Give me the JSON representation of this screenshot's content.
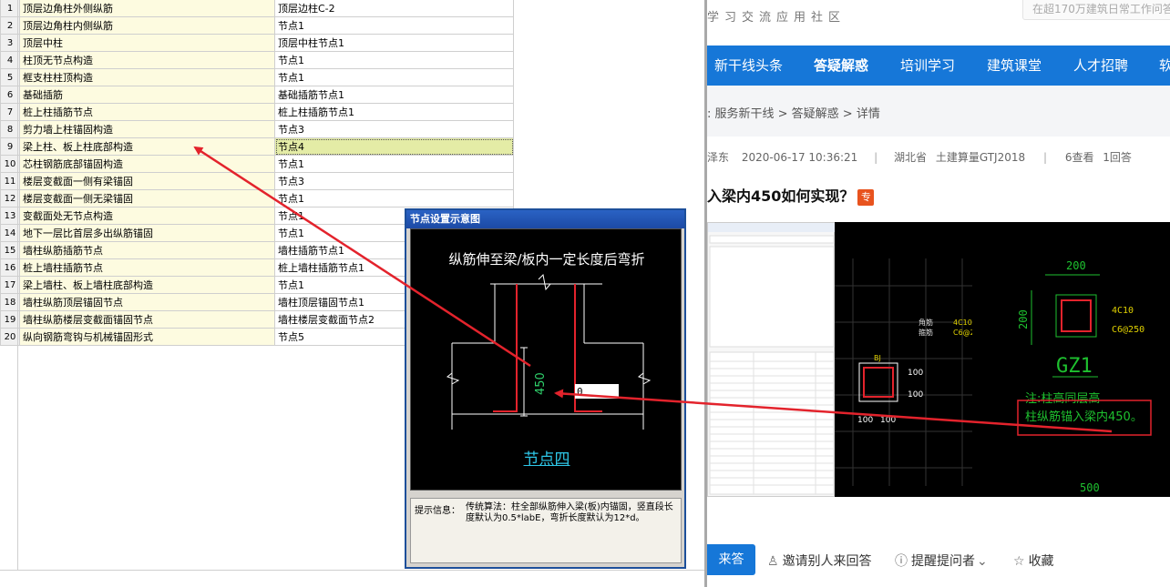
{
  "settings_table": {
    "rows": [
      {
        "num": "1",
        "name": "顶层边角柱外侧纵筋",
        "value": "顶层边柱C-2"
      },
      {
        "num": "2",
        "name": "顶层边角柱内侧纵筋",
        "value": "节点1"
      },
      {
        "num": "3",
        "name": "顶层中柱",
        "value": "顶层中柱节点1"
      },
      {
        "num": "4",
        "name": "柱顶无节点构造",
        "value": "节点1"
      },
      {
        "num": "5",
        "name": "框支柱柱顶构造",
        "value": "节点1"
      },
      {
        "num": "6",
        "name": "基础插筋",
        "value": "基础插筋节点1"
      },
      {
        "num": "7",
        "name": "桩上柱插筋节点",
        "value": "桩上柱插筋节点1"
      },
      {
        "num": "8",
        "name": "剪力墙上柱锚固构造",
        "value": "节点3"
      },
      {
        "num": "9",
        "name": "梁上柱、板上柱底部构造",
        "value": "节点4"
      },
      {
        "num": "10",
        "name": "芯柱钢筋底部锚固构造",
        "value": "节点1"
      },
      {
        "num": "11",
        "name": "楼层变截面一侧有梁锚固",
        "value": "节点3"
      },
      {
        "num": "12",
        "name": "楼层变截面一侧无梁锚固",
        "value": "节点1"
      },
      {
        "num": "13",
        "name": "变截面处无节点构造",
        "value": "节点1"
      },
      {
        "num": "14",
        "name": "地下一层比首层多出纵筋锚固",
        "value": "节点1"
      },
      {
        "num": "15",
        "name": "墙柱纵筋插筋节点",
        "value": "墙柱插筋节点1"
      },
      {
        "num": "16",
        "name": "桩上墙柱插筋节点",
        "value": "桩上墙柱插筋节点1"
      },
      {
        "num": "17",
        "name": "梁上墙柱、板上墙柱底部构造",
        "value": "节点1"
      },
      {
        "num": "18",
        "name": "墙柱纵筋顶层锚固节点",
        "value": "墙柱顶层锚固节点1"
      },
      {
        "num": "19",
        "name": "墙柱纵筋楼层变截面锚固节点",
        "value": "墙柱楼层变截面节点2"
      },
      {
        "num": "20",
        "name": "纵向钢筋弯钩与机械锚固形式",
        "value": "节点5"
      }
    ],
    "selected_row": "9"
  },
  "dialog": {
    "title": "节点设置示意图",
    "caption": "纵筋伸至梁/板内一定长度后弯折",
    "dimension": "450",
    "input_value": "0",
    "node_name": "节点四",
    "info_label": "提示信息：",
    "info_text": "传统算法：柱全部纵筋伸入梁(板)内锚固，竖直段长度默认为0.5*labE，弯折长度默认为12*d。"
  },
  "web": {
    "tagline": "学习交流应用社区",
    "search_placeholder": "在超170万建筑日常工作问答",
    "nav": [
      "新干线头条",
      "答疑解惑",
      "培训学习",
      "建筑课堂",
      "人才招聘",
      "软"
    ],
    "nav_active": "答疑解惑",
    "breadcrumb": ": 服务新干线 > 答疑解惑 > 详情",
    "meta": {
      "author": "泽东",
      "date": "2020-06-17 10:36:21",
      "sep": "|",
      "region": "湖北省",
      "product": "土建算量GTJ2018",
      "views": "6查看",
      "answers": "1回答"
    },
    "question_title": "入梁内450如何实现？",
    "question_badge": "专",
    "screenshot": {
      "cad_left_labels": [
        "角筋",
        "箍筋"
      ],
      "cad_left_values": [
        "4C10",
        "C6@2"
      ],
      "cad_left_name": "BJ",
      "cad_dims": [
        "100",
        "100",
        "100",
        "100"
      ],
      "cad_right_dims": [
        "200",
        "200",
        "500"
      ],
      "cad_right_rebar": [
        "4C10",
        "C6@250"
      ],
      "cad_right_name": "GZ1",
      "cad_right_note": [
        "注:柱高同层高",
        "柱纵筋锚入梁内450。"
      ]
    },
    "answer_button": "来答",
    "actions": [
      {
        "icon": "person-icon",
        "label": "邀请别人来回答"
      },
      {
        "icon": "info-icon",
        "label": "提醒提问者"
      },
      {
        "icon": "star-icon",
        "label": "收藏"
      }
    ]
  }
}
